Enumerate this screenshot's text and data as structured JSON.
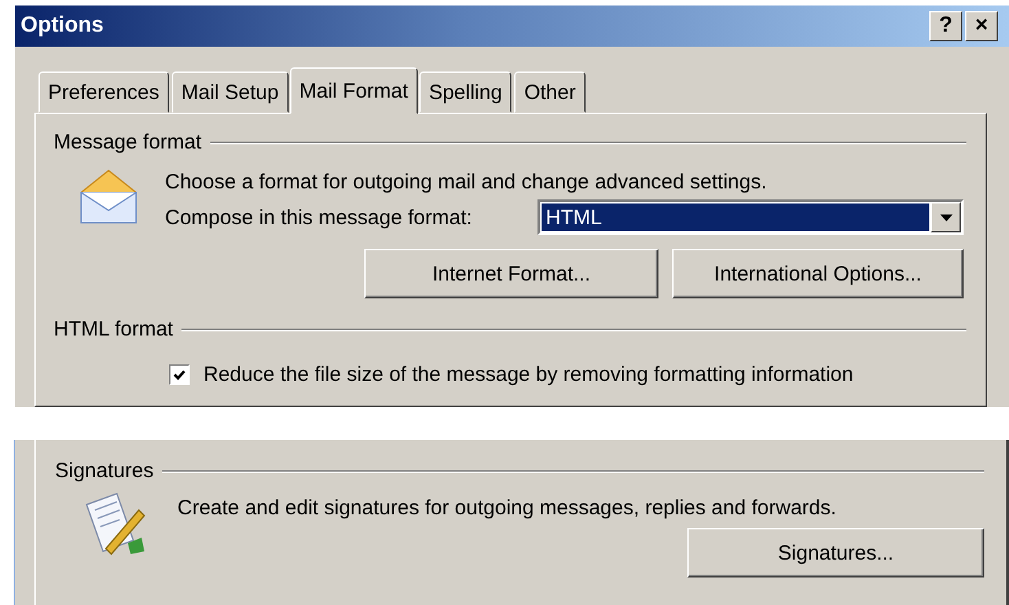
{
  "window": {
    "title": "Options",
    "title_buttons": [
      "?",
      "×"
    ]
  },
  "tabs": [
    {
      "label": "Preferences",
      "selected": false
    },
    {
      "label": "Mail Setup",
      "selected": false
    },
    {
      "label": "Mail Format",
      "selected": true
    },
    {
      "label": "Spelling",
      "selected": false
    },
    {
      "label": "Other",
      "selected": false
    }
  ],
  "message_format": {
    "legend": "Message format",
    "description": "Choose a format for outgoing mail and change advanced settings.",
    "compose_label": "Compose in this message format:",
    "format_select": {
      "value": "HTML"
    },
    "buttons": [
      "Internet Format...",
      "International Options..."
    ]
  },
  "html_format": {
    "legend": "HTML format",
    "options": [
      {
        "label": "Reduce the file size of the message by removing formatting information",
        "checked": true
      }
    ]
  },
  "signatures": {
    "legend": "Signatures",
    "description": "Create and edit signatures for outgoing messages, replies and forwards.",
    "buttons": [
      "Signatures..."
    ]
  }
}
